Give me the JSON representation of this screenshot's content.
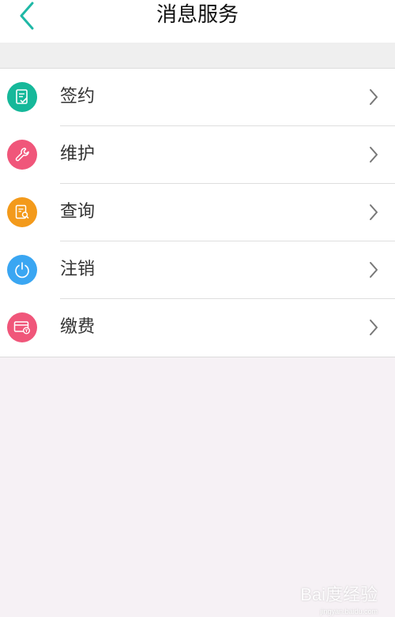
{
  "header": {
    "title": "消息服务",
    "back_icon": "chevron-left-icon"
  },
  "menu": {
    "items": [
      {
        "label": "签约",
        "icon": "contract-check-icon",
        "color": "#16b89a"
      },
      {
        "label": "维护",
        "icon": "wrench-icon",
        "color": "#f0567a"
      },
      {
        "label": "查询",
        "icon": "document-search-icon",
        "color": "#f39a1b"
      },
      {
        "label": "注销",
        "icon": "power-icon",
        "color": "#3aa6f2"
      },
      {
        "label": "缴费",
        "icon": "card-pay-icon",
        "color": "#f0567a"
      }
    ],
    "chevron_icon": "chevron-right-icon"
  },
  "colors": {
    "accent": "#1fb8a6",
    "background": "#f6f1f5"
  },
  "watermark": {
    "text": "Bai度经验",
    "sub": "jingyan.baidu.com"
  }
}
